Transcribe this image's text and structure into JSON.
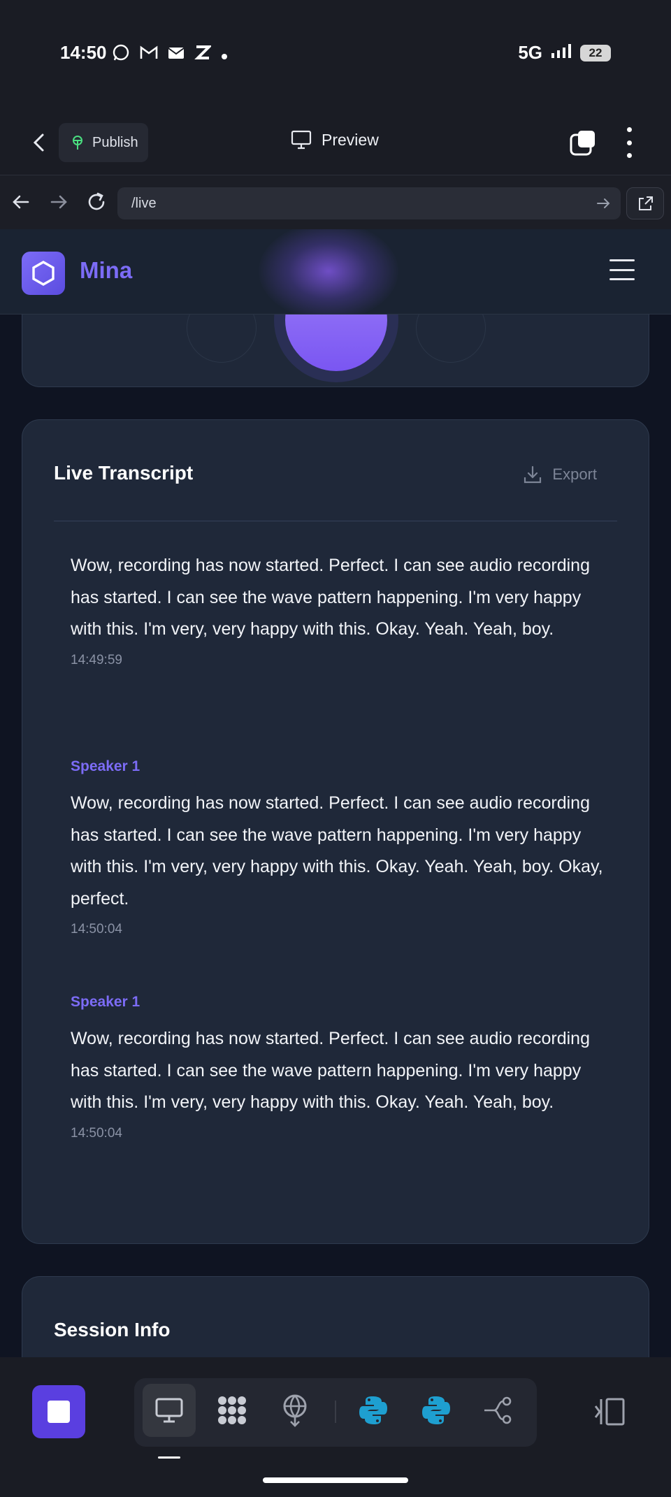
{
  "status_bar": {
    "time": "14:50",
    "notification_icons": [
      "whatsapp-icon",
      "gmail-icon",
      "mail-icon",
      "z-app-icon",
      "dot-icon"
    ],
    "network": "5G",
    "battery": "22"
  },
  "editor_bar": {
    "publish_label": "Publish",
    "preview_label": "Preview"
  },
  "browser": {
    "url": "/live"
  },
  "app": {
    "brand_name": "Mina"
  },
  "transcript": {
    "title": "Live Transcript",
    "export_label": "Export",
    "entries": [
      {
        "speaker": "",
        "text": "Wow, recording has now started. Perfect. I can see audio recording has started. I can see the wave pattern happening. I'm very happy with this. I'm very, very happy with this. Okay. Yeah. Yeah, boy.",
        "time": "14:49:59"
      },
      {
        "speaker": "Speaker 1",
        "text": "Wow, recording has now started. Perfect. I can see audio recording has started. I can see the wave pattern happening. I'm very happy with this. I'm very, very happy with this. Okay. Yeah. Yeah, boy. Okay, perfect.",
        "time": "14:50:04"
      },
      {
        "speaker": "Speaker 1",
        "text": "Wow, recording has now started. Perfect. I can see audio recording has started. I can see the wave pattern happening. I'm very happy with this. I'm very, very happy with this. Okay. Yeah. Yeah, boy.",
        "time": "14:50:04"
      }
    ]
  },
  "session": {
    "title": "Session Info"
  },
  "toolbar": {
    "tools": [
      "desktop-icon",
      "grid-app-icon",
      "deploy-icon",
      "python-icon",
      "python-icon",
      "git-branch-icon"
    ]
  },
  "colors": {
    "accent": "#7c6cf6",
    "stop_button": "#5a3fe0",
    "card_bg": "#1f2839",
    "page_bg": "#0f1422"
  }
}
